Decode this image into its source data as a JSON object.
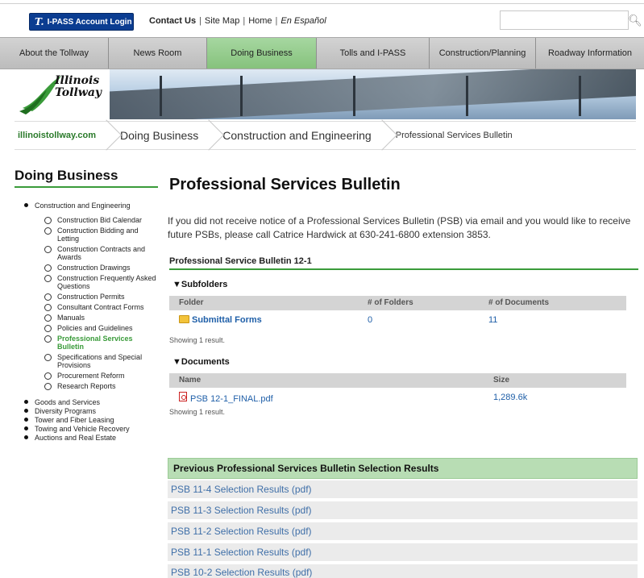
{
  "header": {
    "ipass_logo": "T.",
    "ipass_label": "I-PASS Account Login",
    "links": [
      "Contact Us",
      "Site Map",
      "Home",
      "En Español"
    ],
    "search_placeholder": ""
  },
  "nav": {
    "items": [
      {
        "label": "About the Tollway"
      },
      {
        "label": "News Room"
      },
      {
        "label": "Doing Business"
      },
      {
        "label": "Tolls and I-PASS"
      },
      {
        "label": "Construction/Planning"
      },
      {
        "label": "Roadway Information"
      }
    ],
    "active_index": 2,
    "active_color": "#8cc784"
  },
  "banner": {
    "logo_line1": "Illinois",
    "logo_line2": "Tollway"
  },
  "breadcrumb": [
    "illinoistollway.com",
    "Doing Business",
    "Construction and Engineering",
    "Professional Services Bulletin"
  ],
  "sidebar": {
    "title": "Doing Business",
    "top_item": "Construction and Engineering",
    "sub_items": [
      "Construction Bid Calendar",
      "Construction Bidding and Letting",
      "Construction Contracts and Awards",
      "Construction Drawings",
      "Construction Frequently Asked Questions",
      "Construction Permits",
      "Consultant Contract Forms",
      "Manuals",
      "Policies and Guidelines",
      "Professional Services Bulletin",
      "Specifications and Special Provisions",
      "Procurement Reform",
      "Research Reports"
    ],
    "active_sub": "Professional Services Bulletin",
    "other_items": [
      "Goods and Services",
      "Diversity Programs",
      "Tower and Fiber Leasing",
      "Towing and Vehicle Recovery",
      "Auctions and Real Estate"
    ]
  },
  "main": {
    "title": "Professional Services Bulletin",
    "intro": "If you did not receive notice of a Professional Services Bulletin (PSB) via email and you would like to receive future PSBs, please call Catrice Hardwick at 630-241-6800 extension 3853.",
    "bulletin_heading": "Professional Service Bulletin 12-1",
    "subfolders": {
      "label": "Subfolders",
      "columns": [
        "Folder",
        "# of Folders",
        "# of Documents"
      ],
      "rows": [
        {
          "name": "Submittal Forms",
          "folders": "0",
          "documents": "11"
        }
      ],
      "showing": "Showing 1 result."
    },
    "documents": {
      "label": "Documents",
      "columns": [
        "Name",
        "Size"
      ],
      "rows": [
        {
          "name": "PSB 12-1_FINAL.pdf",
          "size": "1,289.6k"
        }
      ],
      "showing": "Showing 1 result."
    },
    "previous": {
      "heading": "Previous Professional Services Bulletin Selection Results",
      "items": [
        "PSB 11-4 Selection Results (pdf)",
        "PSB 11-3 Selection Results (pdf)",
        "PSB 11-2 Selection Results (pdf)",
        "PSB 11-1 Selection Results (pdf)",
        "PSB 10-2 Selection Results (pdf)"
      ]
    }
  },
  "colors": {
    "accent_green": "#3a9b3a",
    "link_blue": "#1f5fa8",
    "ipass_blue": "#0b3d91"
  }
}
